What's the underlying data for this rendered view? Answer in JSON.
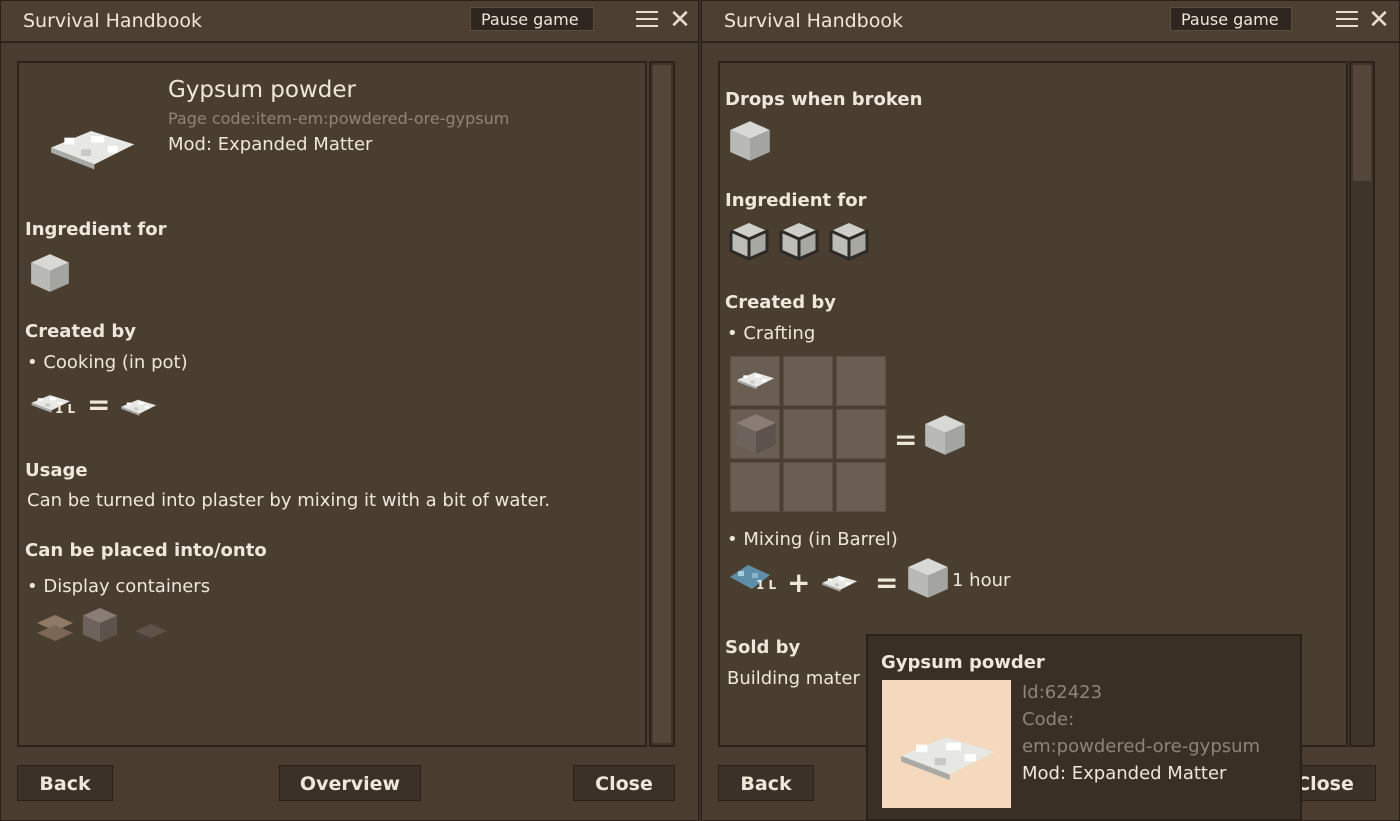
{
  "left": {
    "title": "Survival Handbook",
    "pause_label": "Pause game",
    "item_name": "Gypsum powder",
    "page_code": "Page code:item-em:powdered-ore-gypsum",
    "mod": "Mod: Expanded Matter",
    "ingredient_for": "Ingredient for",
    "created_by": "Created by",
    "cooking": "• Cooking (in pot)",
    "liters": "1 L",
    "equals": "=",
    "usage_heading": "Usage",
    "usage_text": "Can be turned into plaster by mixing it with a bit of water.",
    "placed_heading": "Can be placed into/onto",
    "display_containers": "• Display containers",
    "back": "Back",
    "overview": "Overview",
    "close": "Close"
  },
  "right": {
    "title": "Survival Handbook",
    "pause_label": "Pause game",
    "drops_heading": "Drops when broken",
    "ingredient_for": "Ingredient for",
    "created_by": "Created by",
    "crafting": "• Crafting",
    "equals": "=",
    "mixing": "• Mixing (in Barrel)",
    "liters": "1 L",
    "plus": "+",
    "duration": "1 hour",
    "sold_by": "Sold by",
    "building_mater": "Building mater",
    "back": "Back",
    "close": "Close"
  },
  "tooltip": {
    "name": "Gypsum powder",
    "id": "Id:62423",
    "code_label": "Code:",
    "code": "em:powdered-ore-gypsum",
    "mod": "Mod: Expanded Matter"
  },
  "icons": {
    "menu": "hamburger-menu-icon",
    "close": "close-icon"
  },
  "colors": {
    "panel": "#4a3d30",
    "text": "#efe7da",
    "tooltip_image_bg": "#f4d9bf"
  }
}
